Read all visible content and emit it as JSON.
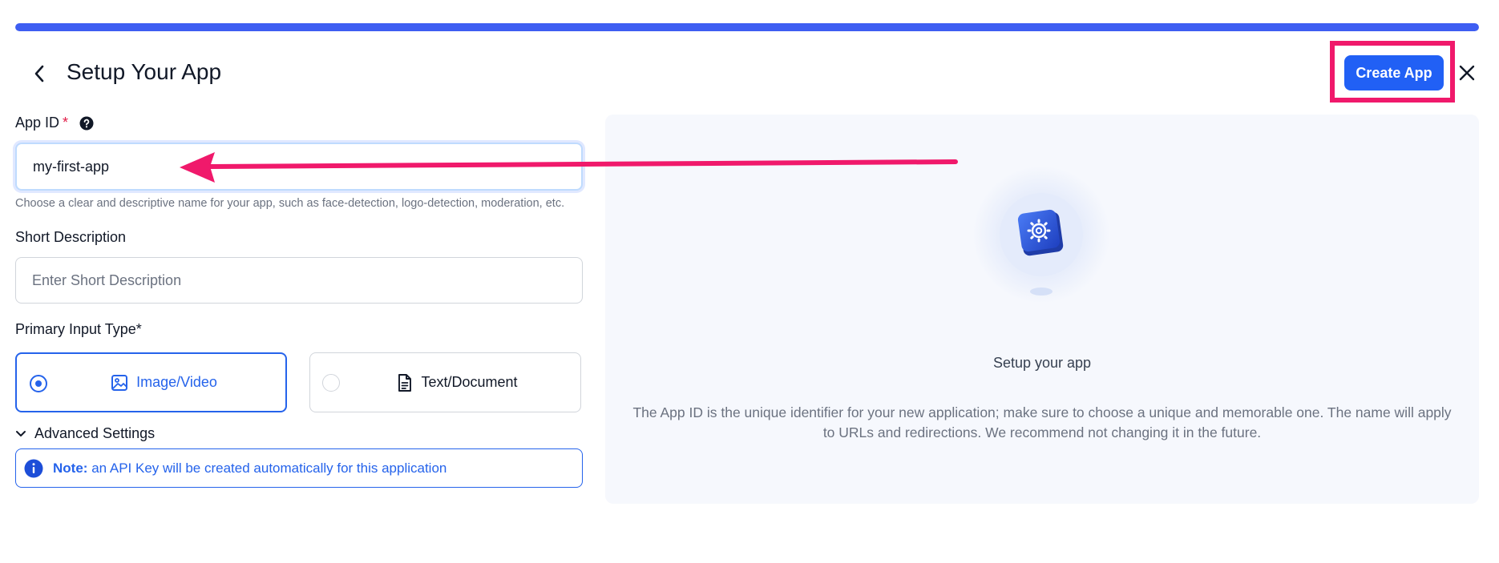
{
  "progress": {
    "value_percent": 100,
    "color": "#3e5ef2"
  },
  "header": {
    "title": "Setup Your App",
    "back_icon": "chevron-left-icon",
    "create_label": "Create App",
    "close_icon": "close-icon"
  },
  "form": {
    "app_id": {
      "label": "App ID",
      "required_mark": "*",
      "help_icon": "question-circle-icon",
      "value": "my-first-app",
      "helper": "Choose a clear and descriptive name for your app, such as face-detection, logo-detection, moderation, etc."
    },
    "short_description": {
      "label": "Short Description",
      "placeholder": "Enter Short Description",
      "value": ""
    },
    "primary_input": {
      "label": "Primary Input Type*",
      "options": [
        {
          "label": "Image/Video",
          "icon": "image-icon",
          "selected": true
        },
        {
          "label": "Text/Document",
          "icon": "document-icon",
          "selected": false
        }
      ]
    },
    "advanced_settings": {
      "label": "Advanced Settings",
      "icon": "chevron-down-icon"
    },
    "note": {
      "prefix": "Note:",
      "text": "an API Key will be created automatically for this application",
      "icon": "info-icon"
    }
  },
  "panel": {
    "illustration_icon": "gear-box-icon",
    "title": "Setup your app",
    "description": "The App ID is the unique identifier for your new application; make sure to choose a unique and memorable one. The name will apply to URLs and redirections. We recommend not changing it in the future."
  },
  "colors": {
    "accent": "#2563eb",
    "primary_button": "#2160f5",
    "annotation": "#f0196b",
    "panel_bg": "#f6f8fd"
  }
}
